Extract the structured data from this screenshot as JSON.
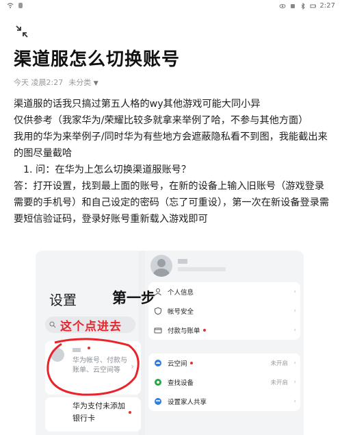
{
  "status_bar": {
    "time": "2:27"
  },
  "header": {
    "collapse_icon": "collapse-arrows-icon"
  },
  "article": {
    "title": "渠道服怎么切换账号",
    "meta": {
      "date": "今天 凌晨2:27",
      "category": "未分类"
    },
    "paragraphs": [
      "渠道服的话我只搞过第五人格的wy其他游戏可能大同小异",
      "仅供参考（我家华为/荣耀比较多就拿来举例了哈，不参与其他方面）",
      "我用的华为来举例子/同时华为有些地方会遮蔽隐私看不到图，我能截出来的图尽量截哈"
    ],
    "list_item": "1. 问：在华为上怎么切换渠道服账号？",
    "answer": "答：打开设置，找到最上面的账号，在新的设备上输入旧账号（游戏登录需要的手机号）和自己设定的密码（忘了可重设），第一次在新设备登录需要短信验证码，登录好账号重新载入游戏即可"
  },
  "screenshot": {
    "settings_title": "设置",
    "search_icon": "search-icon",
    "account_desc": "华为帐号、付款与账单、云空间等",
    "payment_text": "华为支付未添加银行卡",
    "menu_group_1": [
      {
        "label": "个人信息",
        "icon": "person-icon"
      },
      {
        "label": "帐号安全",
        "icon": "shield-icon"
      },
      {
        "label": "付款与账单",
        "icon": "wallet-icon",
        "dot": true
      }
    ],
    "menu_group_2": [
      {
        "label": "云空间",
        "icon": "cloud-icon",
        "right": "未开启",
        "dot": true
      },
      {
        "label": "查找设备",
        "icon": "locate-icon",
        "right": "未开启"
      },
      {
        "label": "设置家人共享",
        "icon": "family-icon"
      }
    ],
    "annotation_step": "第一步",
    "annotation_click": "这个点进去"
  },
  "colors": {
    "annotation_red": "#e8242b",
    "badge_red": "#e03131"
  }
}
